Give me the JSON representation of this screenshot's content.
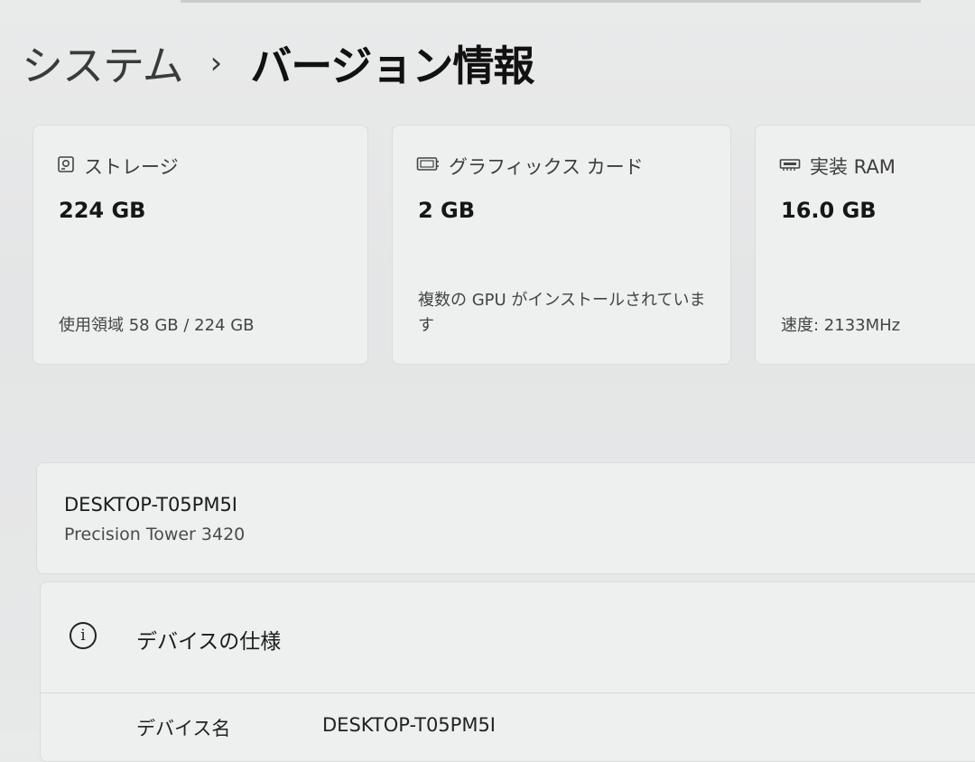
{
  "breadcrumb": {
    "parent": "システム",
    "separator": "›",
    "current": "バージョン情報"
  },
  "cards": {
    "storage": {
      "icon": "storage-drive-icon",
      "label": "ストレージ",
      "value": "224 GB",
      "footer": "使用領域 58 GB / 224 GB"
    },
    "graphics": {
      "icon": "display-card-icon",
      "label": "グラフィックス カード",
      "value": "2 GB",
      "footer": "複数の GPU がインストールされています"
    },
    "ram": {
      "icon": "memory-chip-icon",
      "label": "実装 RAM",
      "value": "16.0 GB",
      "footer": "速度: 2133MHz"
    }
  },
  "device": {
    "name": "DESKTOP-T05PM5I",
    "model": "Precision Tower 3420"
  },
  "specs": {
    "icon": "info-icon",
    "title": "デバイスの仕様",
    "rows": [
      {
        "label": "デバイス名",
        "value": "DESKTOP-T05PM5I"
      }
    ]
  }
}
